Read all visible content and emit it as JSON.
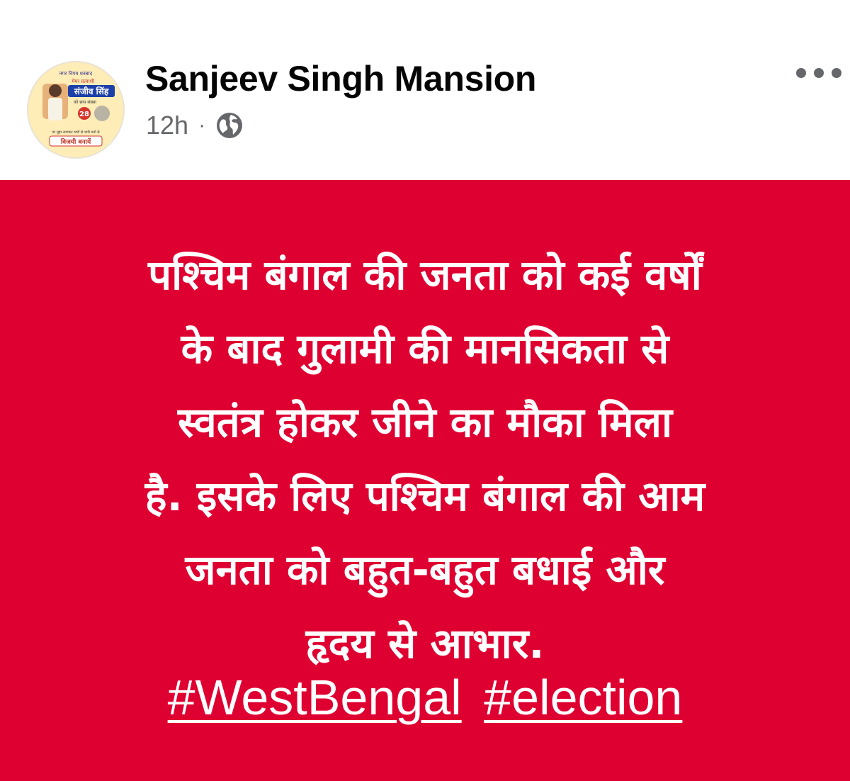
{
  "post": {
    "author": "Sanjeev Singh Mansion",
    "timestamp": "12h",
    "separator": "·",
    "audience_icon": "globe-icon",
    "more_icon": "more-horizontal-icon",
    "avatar": {
      "line1": "नगर निगम धनबाद",
      "line2": "मेयर प्रत्याशी",
      "name": "संजीव सिंह",
      "line3": "को छाप संख्या",
      "number": "28",
      "line4": "पर मुहर लगाकर भारी से भारी मतों से",
      "slogan": "विजयी बनायें"
    },
    "text_lines": [
      "पश्चिम बंगाल की जनता को कई वर्षों",
      "के बाद गुलामी की मानसिकता से",
      "स्वतंत्र होकर जीने का मौका मिला",
      "है. इसके लिए पश्चिम बंगाल की आम",
      "जनता को बहुत-बहुत बधाई और",
      "हृदय से आभार."
    ],
    "hashtags": [
      "#WestBengal",
      "#election"
    ],
    "background_color": "#df0032",
    "text_color": "#ffffff"
  }
}
